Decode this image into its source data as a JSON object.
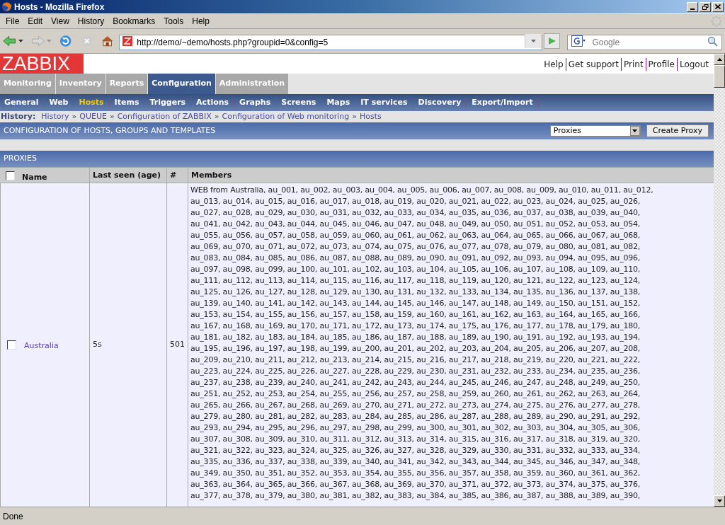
{
  "window": {
    "title": "Hosts - Mozilla Firefox"
  },
  "menu": [
    {
      "label": "File"
    },
    {
      "label": "Edit"
    },
    {
      "label": "View"
    },
    {
      "label": "History"
    },
    {
      "label": "Bookmarks"
    },
    {
      "label": "Tools"
    },
    {
      "label": "Help"
    }
  ],
  "address": {
    "value": "http://demo/~demo/hosts.php?groupid=0&config=5"
  },
  "search": {
    "placeholder": "Google"
  },
  "logo": "ZABBIX",
  "top_links": [
    {
      "label": "Help"
    },
    {
      "label": "Get support"
    },
    {
      "label": "Print"
    },
    {
      "label": "Profile"
    },
    {
      "label": "Logout"
    }
  ],
  "main_tabs": [
    {
      "label": "Monitoring",
      "selected": false
    },
    {
      "label": "Inventory",
      "selected": false
    },
    {
      "label": "Reports",
      "selected": false
    },
    {
      "label": "Configuration",
      "selected": true
    },
    {
      "label": "Administration",
      "selected": false
    }
  ],
  "sub_tabs": [
    {
      "label": "General",
      "selected": false
    },
    {
      "label": "Web",
      "selected": false
    },
    {
      "label": "Hosts",
      "selected": true
    },
    {
      "label": "Items",
      "selected": false
    },
    {
      "label": "Triggers",
      "selected": false
    },
    {
      "label": "Actions",
      "selected": false
    },
    {
      "label": "Graphs",
      "selected": false
    },
    {
      "label": "Screens",
      "selected": false
    },
    {
      "label": "Maps",
      "selected": false
    },
    {
      "label": "IT services",
      "selected": false
    },
    {
      "label": "Discovery",
      "selected": false
    },
    {
      "label": "Export/Import",
      "selected": false
    }
  ],
  "history": {
    "label": "History:",
    "separator": "»",
    "items": [
      "History",
      "QUEUE",
      "Configuration of ZABBIX",
      "Configuration of Web monitoring",
      "Hosts"
    ]
  },
  "header": {
    "title": "CONFIGURATION OF HOSTS, GROUPS AND TEMPLATES",
    "select_value": "Proxies",
    "button": "Create Proxy"
  },
  "table": {
    "title": "PROXIES",
    "select_all_checked": false,
    "columns": [
      "Name",
      "Last seen (age)",
      "#",
      "Members"
    ],
    "rows": [
      {
        "checked": false,
        "name": "Australia",
        "last_seen": "5s",
        "count": "501",
        "members_lines": [
          "WEB from Australia, au_001, au_002, au_003, au_004, au_005, au_006, au_007, au_008, au_009, au_010, au_011, au_012,",
          "au_013, au_014, au_015, au_016, au_017, au_018, au_019, au_020, au_021, au_022, au_023, au_024, au_025, au_026,",
          "au_027, au_028, au_029, au_030, au_031, au_032, au_033, au_034, au_035, au_036, au_037, au_038, au_039, au_040,",
          "au_041, au_042, au_043, au_044, au_045, au_046, au_047, au_048, au_049, au_050, au_051, au_052, au_053, au_054,",
          "au_055, au_056, au_057, au_058, au_059, au_060, au_061, au_062, au_063, au_064, au_065, au_066, au_067, au_068,",
          "au_069, au_070, au_071, au_072, au_073, au_074, au_075, au_076, au_077, au_078, au_079, au_080, au_081, au_082,",
          "au_083, au_084, au_085, au_086, au_087, au_088, au_089, au_090, au_091, au_092, au_093, au_094, au_095, au_096,",
          "au_097, au_098, au_099, au_100, au_101, au_102, au_103, au_104, au_105, au_106, au_107, au_108, au_109, au_110,",
          "au_111, au_112, au_113, au_114, au_115, au_116, au_117, au_118, au_119, au_120, au_121, au_122, au_123, au_124,",
          "au_125, au_126, au_127, au_128, au_129, au_130, au_131, au_132, au_133, au_134, au_135, au_136, au_137, au_138,",
          "au_139, au_140, au_141, au_142, au_143, au_144, au_145, au_146, au_147, au_148, au_149, au_150, au_151, au_152,",
          "au_153, au_154, au_155, au_156, au_157, au_158, au_159, au_160, au_161, au_162, au_163, au_164, au_165, au_166,",
          "au_167, au_168, au_169, au_170, au_171, au_172, au_173, au_174, au_175, au_176, au_177, au_178, au_179, au_180,",
          "au_181, au_182, au_183, au_184, au_185, au_186, au_187, au_188, au_189, au_190, au_191, au_192, au_193, au_194,",
          "au_195, au_196, au_197, au_198, au_199, au_200, au_201, au_202, au_203, au_204, au_205, au_206, au_207, au_208,",
          "au_209, au_210, au_211, au_212, au_213, au_214, au_215, au_216, au_217, au_218, au_219, au_220, au_221, au_222,",
          "au_223, au_224, au_225, au_226, au_227, au_228, au_229, au_230, au_231, au_232, au_233, au_234, au_235, au_236,",
          "au_237, au_238, au_239, au_240, au_241, au_242, au_243, au_244, au_245, au_246, au_247, au_248, au_249, au_250,",
          "au_251, au_252, au_253, au_254, au_255, au_256, au_257, au_258, au_259, au_260, au_261, au_262, au_263, au_264,",
          "au_265, au_266, au_267, au_268, au_269, au_270, au_271, au_272, au_273, au_274, au_275, au_276, au_277, au_278,",
          "au_279, au_280, au_281, au_282, au_283, au_284, au_285, au_286, au_287, au_288, au_289, au_290, au_291, au_292,",
          "au_293, au_294, au_295, au_296, au_297, au_298, au_299, au_300, au_301, au_302, au_303, au_304, au_305, au_306,",
          "au_307, au_308, au_309, au_310, au_311, au_312, au_313, au_314, au_315, au_316, au_317, au_318, au_319, au_320,",
          "au_321, au_322, au_323, au_324, au_325, au_326, au_327, au_328, au_329, au_330, au_331, au_332, au_333, au_334,",
          "au_335, au_336, au_337, au_338, au_339, au_340, au_341, au_342, au_343, au_344, au_345, au_346, au_347, au_348,",
          "au_349, au_350, au_351, au_352, au_353, au_354, au_355, au_356, au_357, au_358, au_359, au_360, au_361, au_362,",
          "au_363, au_364, au_365, au_366, au_367, au_368, au_369, au_370, au_371, au_372, au_373, au_374, au_375, au_376,",
          "au_377, au_378, au_379, au_380, au_381, au_382, au_383, au_384, au_385, au_386, au_387, au_388, au_389, au_390,"
        ]
      }
    ]
  },
  "status_bar": {
    "text": "Done"
  }
}
